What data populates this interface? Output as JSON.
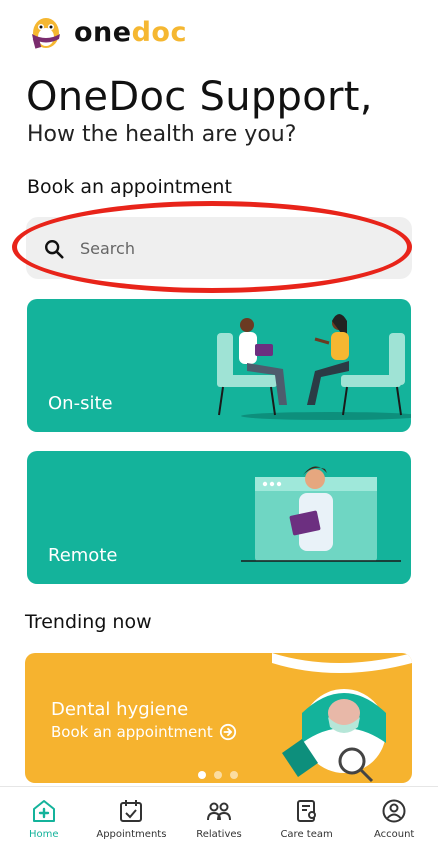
{
  "app": {
    "logo_part1": "one",
    "logo_part2": "doc"
  },
  "header": {
    "title": "OneDoc Support,",
    "subtitle": "How the health are you?"
  },
  "booking": {
    "section_title": "Book an appointment",
    "search_placeholder": "Search"
  },
  "cards": [
    {
      "label": "On-site"
    },
    {
      "label": "Remote"
    }
  ],
  "trending": {
    "section_title": "Trending now",
    "promo_title": "Dental hygiene",
    "promo_link": "Book an appointment",
    "pages": 3,
    "active_page": 0
  },
  "tabs": [
    {
      "label": "Home",
      "icon": "home-plus-icon",
      "active": true
    },
    {
      "label": "Appointments",
      "icon": "calendar-check-icon",
      "active": false
    },
    {
      "label": "Relatives",
      "icon": "relatives-icon",
      "active": false
    },
    {
      "label": "Care team",
      "icon": "care-team-icon",
      "active": false
    },
    {
      "label": "Account",
      "icon": "account-icon",
      "active": false
    }
  ],
  "colors": {
    "accent": "#14b39b",
    "logo_accent": "#f5b731",
    "promo_bg": "#f6b32f",
    "highlight": "#e8241a"
  }
}
